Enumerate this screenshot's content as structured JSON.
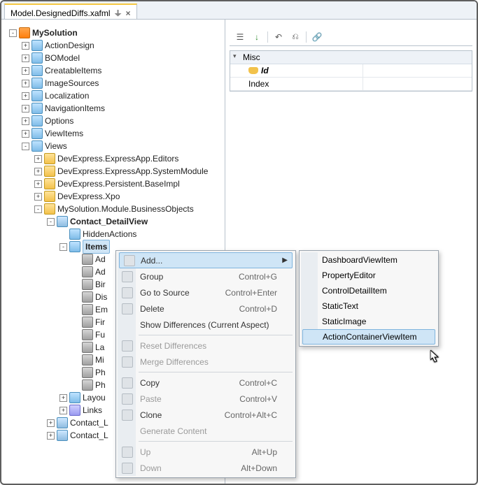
{
  "tab": {
    "title": "Model.DesignedDiffs.xafml"
  },
  "tree": {
    "root": "MySolution",
    "children": [
      "ActionDesign",
      "BOModel",
      "CreatableItems",
      "ImageSources",
      "Localization",
      "NavigationItems",
      "Options",
      "ViewItems",
      "Views"
    ],
    "views_children": [
      "DevExpress.ExpressApp.Editors",
      "DevExpress.ExpressApp.SystemModule",
      "DevExpress.Persistent.BaseImpl",
      "DevExpress.Xpo",
      "MySolution.Module.BusinessObjects"
    ],
    "detail_view": "Contact_DetailView",
    "detail_children": [
      "HiddenActions",
      "Items"
    ],
    "items_children_trunc": [
      "Ad",
      "Ad",
      "Bir",
      "Dis",
      "Em",
      "Fir",
      "Fu",
      "La",
      "Mi",
      "Ph",
      "Ph"
    ],
    "after_items": [
      "Layou",
      "Links"
    ],
    "after_detail": [
      "Contact_L",
      "Contact_L"
    ]
  },
  "properties": {
    "group": "Misc",
    "rows": [
      {
        "name": "Id",
        "value": "",
        "key": true,
        "bold": true
      },
      {
        "name": "Index",
        "value": "",
        "key": false,
        "bold": false
      }
    ]
  },
  "context_menu": {
    "items": [
      {
        "label": "Add...",
        "shortcut": "",
        "enabled": true,
        "arrow": true,
        "highlight": true
      },
      {
        "label": "Group",
        "shortcut": "Control+G",
        "enabled": true
      },
      {
        "label": "Go to Source",
        "shortcut": "Control+Enter",
        "enabled": true
      },
      {
        "label": "Delete",
        "shortcut": "Control+D",
        "enabled": true
      },
      {
        "label": "Show Differences (Current Aspect)",
        "enabled": true,
        "sepAfter": true
      },
      {
        "label": "Reset Differences",
        "enabled": false
      },
      {
        "label": "Merge Differences",
        "enabled": false,
        "sepAfter": true
      },
      {
        "label": "Copy",
        "shortcut": "Control+C",
        "enabled": true
      },
      {
        "label": "Paste",
        "shortcut": "Control+V",
        "enabled": false
      },
      {
        "label": "Clone",
        "shortcut": "Control+Alt+C",
        "enabled": true
      },
      {
        "label": "Generate Content",
        "enabled": false,
        "sepAfter": true
      },
      {
        "label": "Up",
        "shortcut": "Alt+Up",
        "enabled": false
      },
      {
        "label": "Down",
        "shortcut": "Alt+Down",
        "enabled": false
      }
    ]
  },
  "submenu": {
    "items": [
      {
        "label": "DashboardViewItem"
      },
      {
        "label": "PropertyEditor"
      },
      {
        "label": "ControlDetailItem"
      },
      {
        "label": "StaticText"
      },
      {
        "label": "StaticImage"
      },
      {
        "label": "ActionContainerViewItem",
        "highlight": true
      }
    ]
  }
}
